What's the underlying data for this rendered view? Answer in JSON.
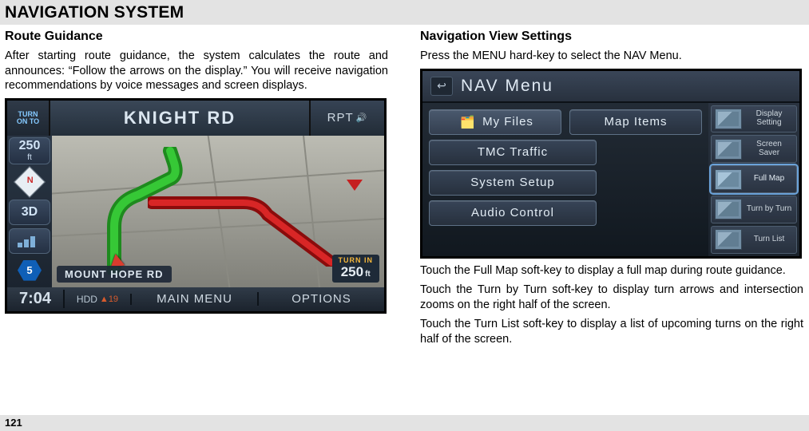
{
  "header": {
    "title": "NAVIGATION SYSTEM"
  },
  "pageNumber": "121",
  "left": {
    "subhead": "Route Guidance",
    "para1": "After starting route guidance, the system calculates the route and announces: “Follow the arrows on the display.” You will receive navigation recommendations by voice messages and screen displays.",
    "screenshot": {
      "turnOn": {
        "line1": "TURN",
        "line2": "ON TO"
      },
      "roadName": "KNIGHT RD",
      "rpt": "RPT",
      "distanceBadge": {
        "value": "250",
        "unit": "ft"
      },
      "compassLetter": "N",
      "threeD": "3D",
      "hexValue": "5",
      "streetLabel": "MOUNT HOPE RD",
      "turnIn": {
        "label": "TURN IN",
        "value": "250",
        "unit": "ft"
      },
      "clock": "7:04",
      "hdd": {
        "label": "HDD",
        "temp": "19"
      },
      "mainMenu": "MAIN MENU",
      "options": "OPTIONS"
    }
  },
  "right": {
    "subhead": "Navigation View Settings",
    "intro": "Press the MENU hard-key to select the NAV Menu.",
    "para2": "Touch the Full Map soft-key to display a full map during route guidance.",
    "para3": "Touch the Turn by Turn soft-key to display turn arrows and intersection zooms on the right half of the screen.",
    "para4": "Touch the Turn List soft-key to display a list of upcoming turns on the right half of the screen.",
    "screenshot": {
      "title": "NAV Menu",
      "buttons": {
        "myFiles": "My Files",
        "mapItems": "Map Items",
        "tmcTraffic": "TMC Traffic",
        "systemSetup": "System Setup",
        "audioControl": "Audio Control"
      },
      "thumbs": {
        "displaySetting": "Display Setting",
        "screenSaver": "Screen Saver",
        "fullMap": "Full Map",
        "turnByTurn": "Turn by Turn",
        "turnList": "Turn List"
      }
    }
  }
}
